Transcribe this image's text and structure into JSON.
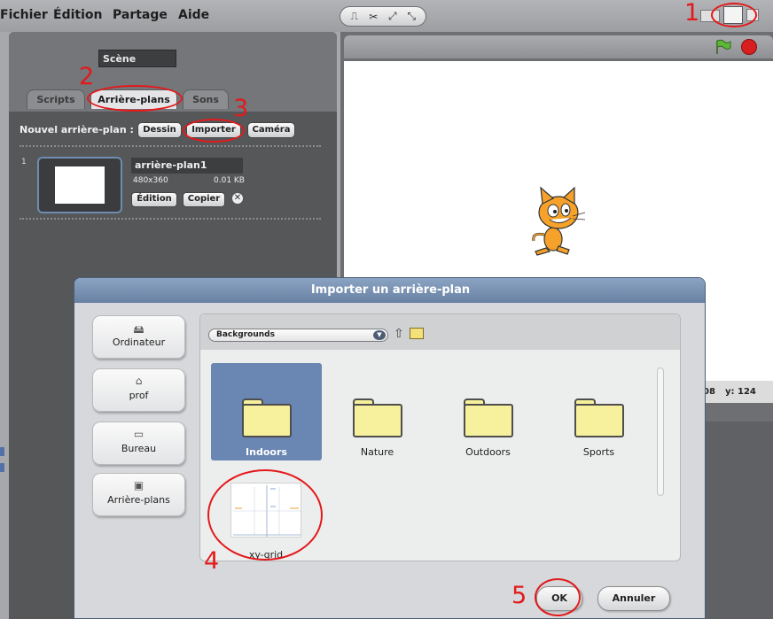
{
  "menu": {
    "items": [
      "Fichier",
      "Édition",
      "Partage",
      "Aide"
    ]
  },
  "toolbar": {
    "tools": [
      "stamp-icon",
      "scissors-icon",
      "grow-icon",
      "shrink-icon"
    ]
  },
  "scene": {
    "name": "Scène"
  },
  "tabs": [
    {
      "label": "Scripts",
      "active": false
    },
    {
      "label": "Arrière-plans",
      "active": true
    },
    {
      "label": "Sons",
      "active": false
    }
  ],
  "backgrounds": {
    "new_label": "Nouvel arrière-plan :",
    "buttons": [
      "Dessin",
      "Importer",
      "Caméra"
    ],
    "costume": {
      "number": "1",
      "name": "arrière-plan1",
      "dimensions": "480x360",
      "size": "0.01 KB",
      "edit_label": "Édition",
      "copy_label": "Copier",
      "delete_glyph": "✕"
    }
  },
  "stage": {
    "coords_x_stub": "08",
    "coords_y": "y:  124"
  },
  "dialog": {
    "title": "Importer un arrière-plan",
    "locations": [
      {
        "label": "Ordinateur",
        "icon": "computer-icon"
      },
      {
        "label": "prof",
        "icon": "home-icon"
      },
      {
        "label": "Bureau",
        "icon": "folder-icon"
      },
      {
        "label": "Arrière-plans",
        "icon": "backgrounds-folder-icon"
      }
    ],
    "current_folder": "Backgrounds",
    "items": [
      {
        "label": "Indoors",
        "type": "folder",
        "selected": true
      },
      {
        "label": "Nature",
        "type": "folder",
        "selected": false
      },
      {
        "label": "Outdoors",
        "type": "folder",
        "selected": false
      },
      {
        "label": "Sports",
        "type": "folder",
        "selected": false
      },
      {
        "label": "xy-grid",
        "type": "image",
        "selected": false
      }
    ],
    "ok_label": "OK",
    "cancel_label": "Annuler"
  },
  "annotations": [
    "1",
    "2",
    "3",
    "4",
    "5"
  ],
  "colors": {
    "annotation": "#e3191b",
    "selected_item": "#6a86b3",
    "dialog_title": "#7590b3"
  }
}
